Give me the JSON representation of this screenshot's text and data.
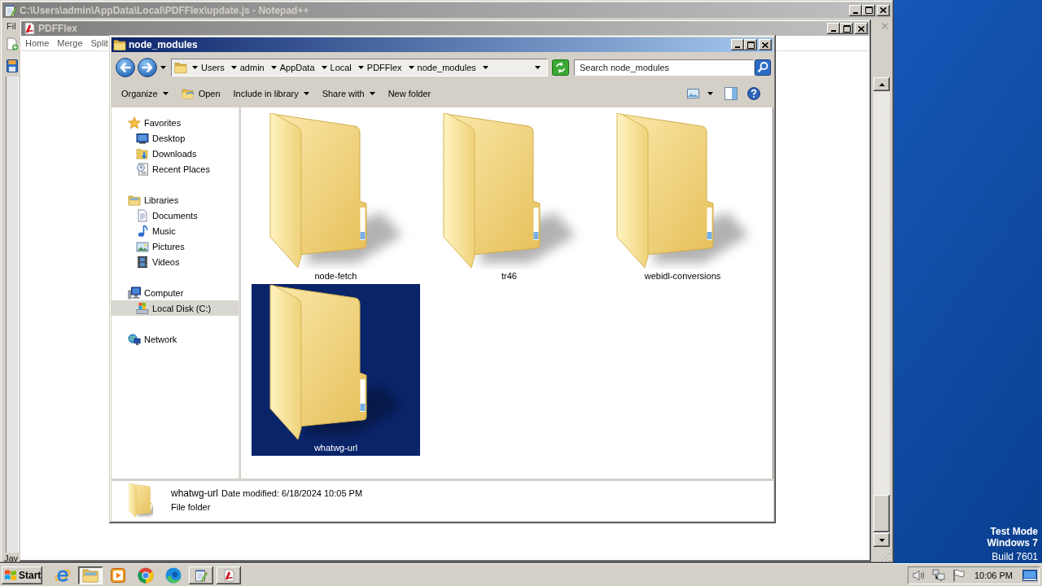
{
  "notepad": {
    "title": "C:\\Users\\admin\\AppData\\Local\\PDFFlex\\update.js - Notepad++",
    "active": false,
    "menu_item": "Fil",
    "status_text": "Jav"
  },
  "pdfflex": {
    "title": "PDFFlex",
    "active": false,
    "menu": [
      "Home",
      "Merge",
      "Split"
    ]
  },
  "explorer": {
    "title": "node_modules",
    "active": true,
    "breadcrumb": [
      "Users",
      "admin",
      "AppData",
      "Local",
      "PDFFlex",
      "node_modules"
    ],
    "search": {
      "placeholder": "Search node_modules"
    },
    "toolbar": [
      {
        "label": "Organize",
        "kind": "menu"
      },
      {
        "label": "Open",
        "kind": "action-icon"
      },
      {
        "label": "Include in library",
        "kind": "menu"
      },
      {
        "label": "Share with",
        "kind": "menu"
      },
      {
        "label": "New folder",
        "kind": "action"
      }
    ],
    "nav": [
      {
        "label": "Favorites",
        "selected": false,
        "children": [
          {
            "label": "Desktop",
            "selected": false
          },
          {
            "label": "Downloads",
            "selected": false
          },
          {
            "label": "Recent Places",
            "selected": false
          }
        ]
      },
      {
        "label": "Libraries",
        "selected": false,
        "children": [
          {
            "label": "Documents",
            "selected": false
          },
          {
            "label": "Music",
            "selected": false
          },
          {
            "label": "Pictures",
            "selected": false
          },
          {
            "label": "Videos",
            "selected": false
          }
        ]
      },
      {
        "label": "Computer",
        "selected": false,
        "children": [
          {
            "label": "Local Disk (C:)",
            "selected": true
          }
        ]
      },
      {
        "label": "Network",
        "selected": false
      }
    ],
    "items": [
      {
        "name": "node-fetch",
        "selected": false
      },
      {
        "name": "tr46",
        "selected": false
      },
      {
        "name": "webidl-conversions",
        "selected": false
      },
      {
        "name": "whatwg-url",
        "selected": true
      }
    ],
    "details": {
      "name": "whatwg-url",
      "modified": "Date modified: 6/18/2024 10:05 PM",
      "type": "File folder"
    }
  },
  "desktop": {
    "test_mode": "Test Mode",
    "os": "Windows 7",
    "build": "Build 7601"
  },
  "taskbar": {
    "start": "Start",
    "apps": [
      {
        "running": false,
        "selected": false
      },
      {
        "running": true,
        "selected": true
      },
      {
        "running": false,
        "selected": false
      },
      {
        "running": false,
        "selected": false
      },
      {
        "running": false,
        "selected": false
      },
      {
        "running": true,
        "selected": false
      },
      {
        "running": true,
        "selected": false
      }
    ],
    "clock": "10:06 PM"
  }
}
